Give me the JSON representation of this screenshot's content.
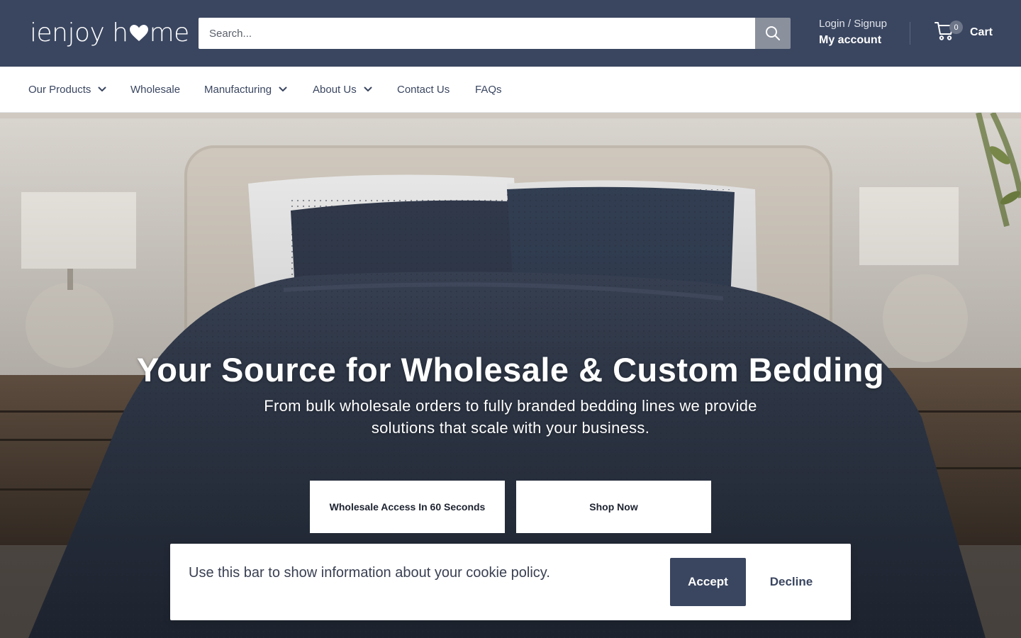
{
  "header": {
    "logo_text_left": "ienjoy h",
    "logo_text_right": "me",
    "search_placeholder": "Search...",
    "login_label": "Login / Signup",
    "account_label": "My account",
    "cart_count": "0",
    "cart_label": "Cart"
  },
  "nav": {
    "items": [
      {
        "label": "Our Products",
        "dropdown": true
      },
      {
        "label": "Wholesale",
        "dropdown": false
      },
      {
        "label": "Manufacturing",
        "dropdown": true
      },
      {
        "label": "About Us",
        "dropdown": true
      },
      {
        "label": "Contact Us",
        "dropdown": false
      },
      {
        "label": "FAQs",
        "dropdown": false
      }
    ]
  },
  "hero": {
    "title": "Your Source for Wholesale & Custom Bedding",
    "subtitle": "From bulk wholesale orders to fully branded bedding lines we provide solutions that scale with your business.",
    "primary_button": "Wholesale Access In 60 Seconds",
    "secondary_button": "Shop Now"
  },
  "cookie": {
    "text": "Use this bar to show information about your cookie policy.",
    "accept_label": "Accept",
    "decline_label": "Decline"
  },
  "colors": {
    "header_bg": "#3a4660",
    "nav_text": "#3a4660",
    "accent": "#3a4660"
  },
  "icons": [
    "heart-icon",
    "search-icon",
    "cart-icon",
    "chevron-down-icon"
  ]
}
